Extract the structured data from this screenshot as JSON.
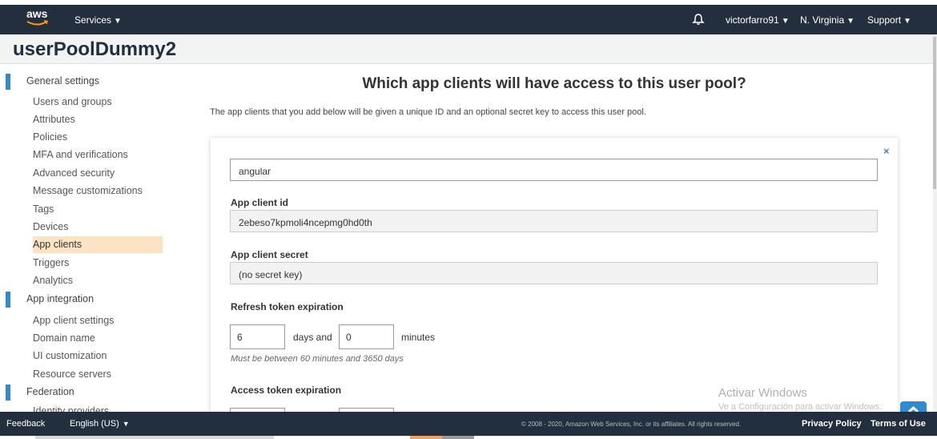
{
  "topbar": {
    "logo_text": "aws",
    "services_label": "Services",
    "user_label": "victorfarro91",
    "region_label": "N. Virginia",
    "support_label": "Support",
    "caret": "▼"
  },
  "page_title": "userPoolDummy2",
  "sidebar": {
    "sections": [
      {
        "label": "General settings",
        "items": [
          "Users and groups",
          "Attributes",
          "Policies",
          "MFA and verifications",
          "Advanced security",
          "Message customizations",
          "Tags",
          "Devices",
          "App clients",
          "Triggers",
          "Analytics"
        ]
      },
      {
        "label": "App integration",
        "items": [
          "App client settings",
          "Domain name",
          "UI customization",
          "Resource servers"
        ]
      },
      {
        "label": "Federation",
        "items": [
          "Identity providers"
        ]
      }
    ],
    "active_item": "App clients"
  },
  "main": {
    "heading": "Which app clients will have access to this user pool?",
    "description": "The app clients that you add below will be given a unique ID and an optional secret key to access this user pool.",
    "close_symbol": "×",
    "app_client_name": "angular",
    "client_id_label": "App client id",
    "client_id_value": "2ebeso7kpmoli4ncepmg0hd0th",
    "client_secret_label": "App client secret",
    "client_secret_value": "(no secret key)",
    "refresh_label": "Refresh token expiration",
    "refresh_days": "6",
    "days_and_text": "days and",
    "refresh_minutes": "0",
    "minutes_text": "minutes",
    "refresh_hint": "Must be between 60 minutes and 3650 days",
    "access_label": "Access token expiration"
  },
  "watermark": {
    "line1": "Activar Windows",
    "line2": "Ve a Configuración para activar Windows."
  },
  "footer": {
    "feedback_label": "Feedback",
    "language_label": "English (US)",
    "copyright": "© 2008 - 2020, Amazon Web Services, Inc. or its affiliates. All rights reserved.",
    "privacy_label": "Privacy Policy",
    "terms_label": "Terms of Use"
  },
  "colors": {
    "nav_bg": "#232f3e",
    "accent_blue": "#2e8bd2",
    "active_item_bg": "#fbe3c4",
    "aws_orange": "#ff9900"
  }
}
